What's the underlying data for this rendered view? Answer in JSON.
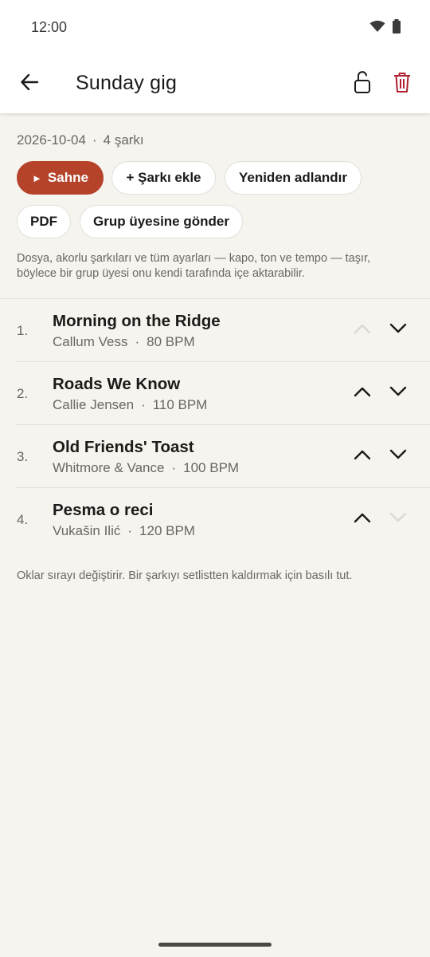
{
  "status_bar": {
    "time": "12:00"
  },
  "app_bar": {
    "title": "Sunday gig"
  },
  "setlist": {
    "date": "2026-10-04",
    "song_count": "4 şarkı"
  },
  "actions": {
    "stage": "Sahne",
    "add_song": "+ Şarkı ekle",
    "rename": "Yeniden adlandır",
    "pdf": "PDF",
    "send_to_member": "Grup üyesine gönder"
  },
  "hint_top": "Dosya, akorlu şarkıları ve tüm ayarları — kapo, ton ve tempo — taşır, böylece bir grup üyesi onu kendi tarafında içe aktarabilir.",
  "songs": [
    {
      "number": "1.",
      "title": "Morning on the Ridge",
      "artist": "Callum Vess",
      "bpm": "80 BPM",
      "up_enabled": false,
      "down_enabled": true
    },
    {
      "number": "2.",
      "title": "Roads We Know",
      "artist": "Callie Jensen",
      "bpm": "110 BPM",
      "up_enabled": true,
      "down_enabled": true
    },
    {
      "number": "3.",
      "title": "Old Friends' Toast",
      "artist": "Whitmore & Vance",
      "bpm": "100 BPM",
      "up_enabled": true,
      "down_enabled": true
    },
    {
      "number": "4.",
      "title": "Pesma o reci",
      "artist": "Vukašin Ilić",
      "bpm": "120 BPM",
      "up_enabled": true,
      "down_enabled": false
    }
  ],
  "hint_bottom": "Oklar sırayı değiştirir. Bir şarkıyı setlistten kaldırmak için basılı tut.",
  "colors": {
    "accent": "#b5432a",
    "delete": "#b0202f",
    "background": "#f6f4ef",
    "arrow_enabled": "#1c1b1a",
    "arrow_disabled": "#dcd9d4"
  },
  "icons": {
    "back": "arrow-left-icon",
    "lock": "lock-open-icon",
    "delete": "trash-icon",
    "play": "play-icon",
    "up": "chevron-up-icon",
    "down": "chevron-down-icon",
    "wifi": "wifi-icon",
    "battery": "battery-icon"
  }
}
